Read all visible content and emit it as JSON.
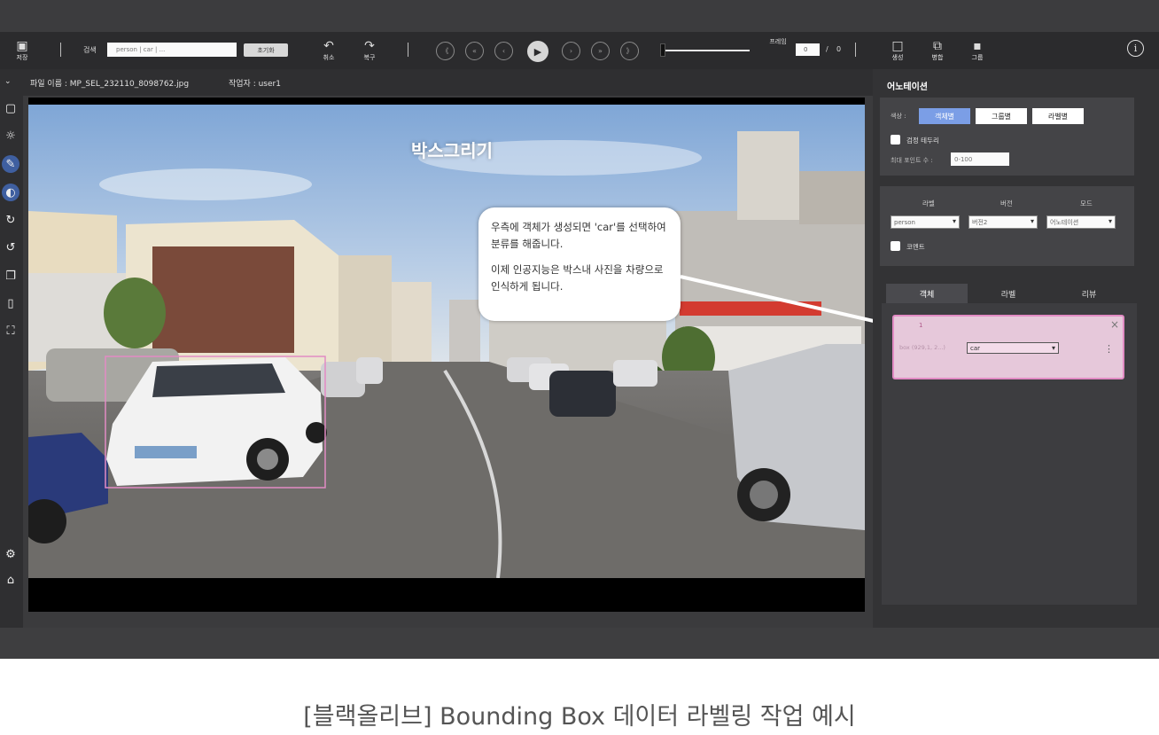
{
  "toolbar": {
    "save_label": "저장",
    "search_label": "검색",
    "search_value": "person | car | ...",
    "reset_label": "초기화",
    "undo_label": "취소",
    "redo_label": "복구",
    "nav_buttons": [
      "《",
      "«",
      "‹",
      "▶",
      "›",
      "»",
      "》"
    ],
    "timeline_progress": 0.0,
    "frame_label": "프레임",
    "frame_value": "0",
    "frame_sep": "/",
    "frame_total": "0",
    "create_label": "생성",
    "merge_label": "병합",
    "group_label": "그룹",
    "info_icon": "info-icon"
  },
  "fileinfo": {
    "collapse_icon": "chevron-down-icon",
    "file_name": "파일 이름 : MP_SEL_232110_8098762.jpg",
    "worker": "작업자 : user1"
  },
  "left_tools": [
    "box-select-icon",
    "brightness-icon",
    "brush-icon",
    "eraser-icon",
    "rotate-cw-icon",
    "rotate-ccw-icon",
    "copy-icon",
    "mouse-icon",
    "fit-screen-icon"
  ],
  "left_bottom_tools": [
    "gear-icon",
    "home-icon"
  ],
  "canvas": {
    "title": "박스그리기",
    "callout_line1": "우측에 객체가 생성되면 'car'를 선택하여 분류를 해줍니다.",
    "callout_line2": "이제 인공지능은 박스내 사진을 차량으로 인식하게 됩니다."
  },
  "panel": {
    "title": "어노테이션",
    "color_label": "색상 :",
    "color_buttons": [
      "객체별",
      "그룹별",
      "라벨별"
    ],
    "border_label": "검정 테두리",
    "max_points_label": "최대 포인트 수 :",
    "max_points_placeholder": "0-100",
    "col_label": "라벨",
    "col_version": "버전",
    "col_mode": "모드",
    "label_select": "person",
    "version_select": "버전2",
    "mode_select": "어노테이션",
    "comment_label": "코멘트",
    "tabs": [
      "객체",
      "라벨",
      "리뷰"
    ],
    "object_id": "1",
    "object_desc": "box (929,1, 2...)",
    "object_label": "car",
    "close_icon": "×",
    "more_icon": "⋮"
  },
  "colors": {
    "accent": "#7b9ee6",
    "box_pink": "#e28bc4",
    "panel_bg": "#333335",
    "toolbar_bg": "#2b2b2d"
  },
  "caption": "[블랙올리브] Bounding Box 데이터 라벨링 작업 예시"
}
